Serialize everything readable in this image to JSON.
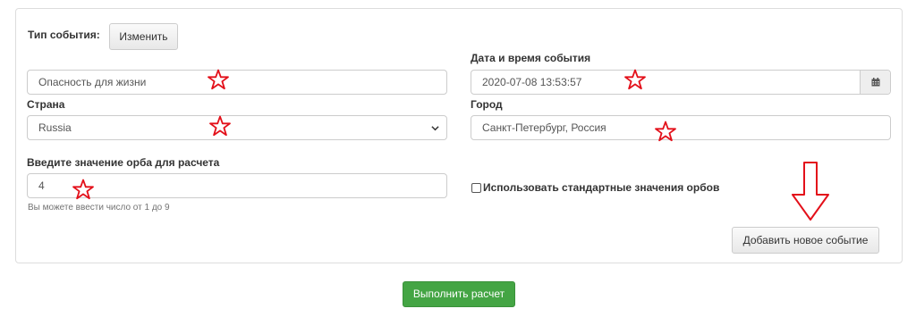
{
  "event_type": {
    "label": "Тип события:",
    "change_button": "Изменить"
  },
  "event_name": {
    "value": "Опасность для жизни"
  },
  "datetime": {
    "label": "Дата и время события",
    "value": "2020-07-08 13:53:57",
    "icon": "calendar-icon"
  },
  "country": {
    "label": "Страна",
    "value": "Russia"
  },
  "city": {
    "label": "Город",
    "value": "Санкт-Петербург, Россия"
  },
  "orb": {
    "label": "Введите значение орба для расчета",
    "value": "4",
    "help": "Вы можете ввести число от 1 до 9"
  },
  "standard_orbs": {
    "label": "Использовать стандартные значения орбов",
    "checked": false
  },
  "add_event_button": "Добавить новое событие",
  "run_button": "Выполнить расчет",
  "colors": {
    "annotation": "#e3101a",
    "primary_green": "#44a544"
  }
}
